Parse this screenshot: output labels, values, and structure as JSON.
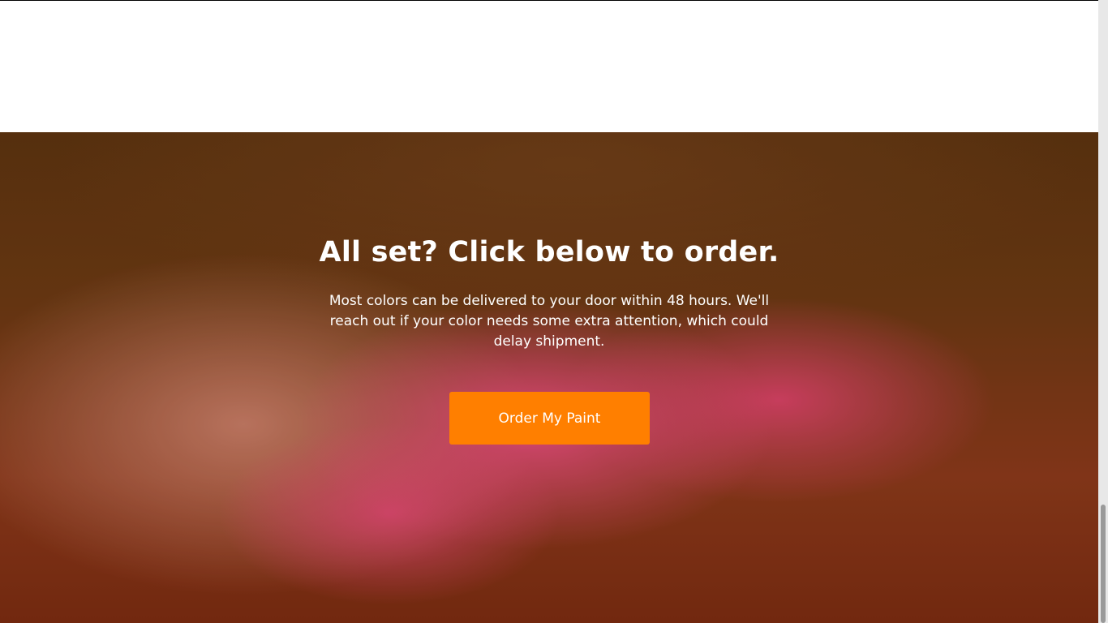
{
  "hero": {
    "title": "All set? Click below to order.",
    "description": "Most colors can be delivered to your door within 48 hours. We'll reach out if your color needs some extra attention, which could delay shipment.",
    "button_label": "Order My Paint",
    "background_image": "hand-holding-pink-powder-paint"
  },
  "colors": {
    "button_bg": "#ff7f00",
    "heading": "#ffffff",
    "page_bg": "#ffffff"
  }
}
